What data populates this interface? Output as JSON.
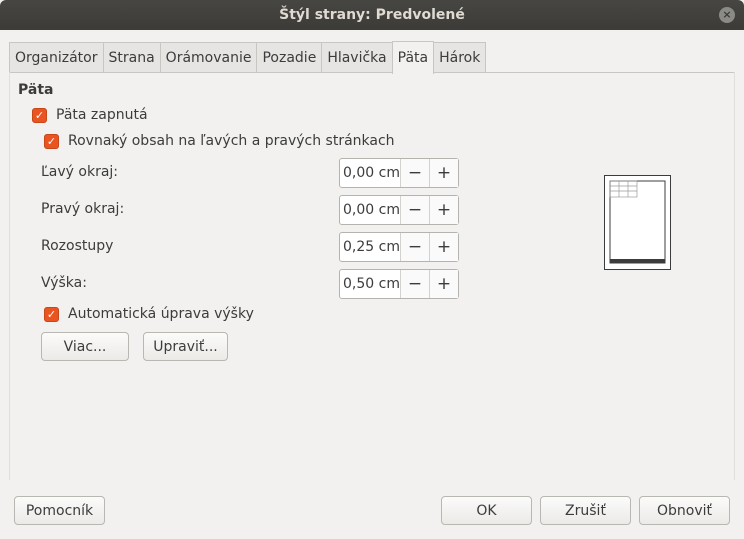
{
  "window": {
    "title": "Štýl strany: Predvolené",
    "close_glyph": "×"
  },
  "tabs": [
    {
      "label": "Organizátor",
      "active": false
    },
    {
      "label": "Strana",
      "active": false
    },
    {
      "label": "Orámovanie",
      "active": false
    },
    {
      "label": "Pozadie",
      "active": false
    },
    {
      "label": "Hlavička",
      "active": false
    },
    {
      "label": "Päta",
      "active": true
    },
    {
      "label": "Hárok",
      "active": false
    }
  ],
  "section": {
    "title": "Päta"
  },
  "checkboxes": {
    "footer_on": {
      "label": "Päta zapnutá",
      "checked": true
    },
    "same_content": {
      "label": "Rovnaký obsah na ľavých a pravých stránkach",
      "checked": true
    },
    "autofit": {
      "label": "Automatická úprava výšky",
      "checked": true
    }
  },
  "fields": [
    {
      "label": "Ľavý okraj:",
      "value": "0,00 cm"
    },
    {
      "label": "Pravý okraj:",
      "value": "0,00 cm"
    },
    {
      "label": "Rozostupy",
      "value": "0,25 cm"
    },
    {
      "label": "Výška:",
      "value": "0,50 cm"
    }
  ],
  "spin": {
    "minus": "−",
    "plus": "+"
  },
  "buttons": {
    "more": "Viac...",
    "edit": "Upraviť...",
    "help": "Pomocník",
    "ok": "OK",
    "cancel": "Zrušiť",
    "reset": "Obnoviť"
  },
  "colors": {
    "accent": "#e95420",
    "titlebar": "#3c3b37"
  },
  "check_glyph": "✓"
}
